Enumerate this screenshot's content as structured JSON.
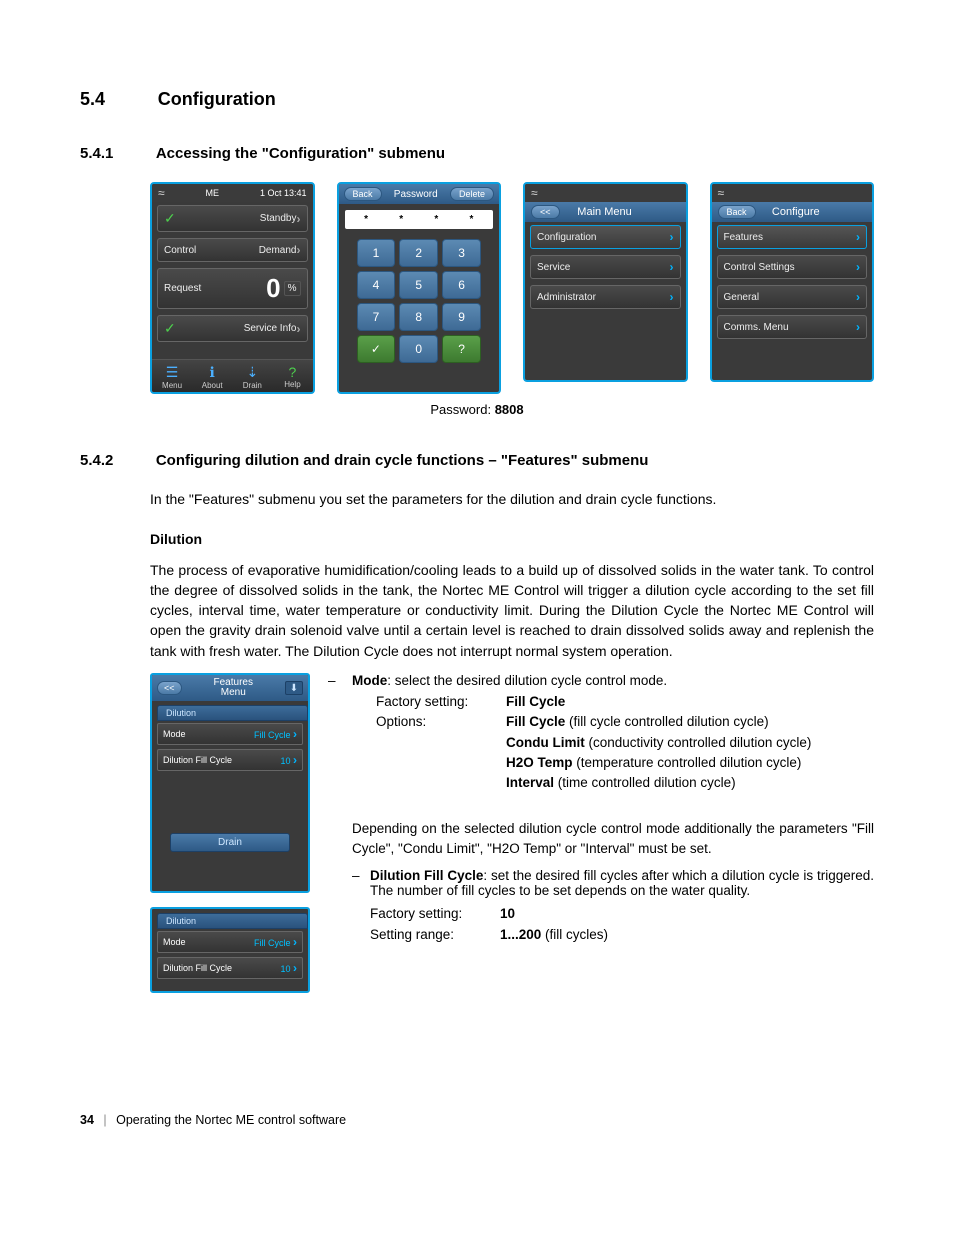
{
  "h1": {
    "num": "5.4",
    "title": "Configuration"
  },
  "h2a": {
    "num": "5.4.1",
    "title": "Accessing the \"Configuration\" submenu"
  },
  "h2b": {
    "num": "5.4.2",
    "title": "Configuring dilution and drain cycle functions – \"Features\" submenu"
  },
  "screen1": {
    "title": "ME",
    "time": "1 Oct 13:41",
    "standby": "Standby",
    "control": "Control",
    "demand": "Demand",
    "request": "Request",
    "reqVal": "0",
    "reqUnit": "%",
    "service": "Service Info",
    "bottom": {
      "menu": "Menu",
      "about": "About",
      "drain": "Drain",
      "help": "Help"
    }
  },
  "screen2": {
    "back": "Back",
    "title": "Password",
    "delete": "Delete",
    "mask": "*",
    "keys": [
      "1",
      "2",
      "3",
      "4",
      "5",
      "6",
      "7",
      "8",
      "9",
      "",
      "0",
      ""
    ]
  },
  "screen3": {
    "back": "<<",
    "title": "Main Menu",
    "items": [
      "Configuration",
      "Service",
      "Administrator"
    ]
  },
  "screen4": {
    "back": "Back",
    "title": "Configure",
    "items": [
      "Features",
      "Control Settings",
      "General",
      "Comms. Menu"
    ]
  },
  "caption": {
    "label": "Password: ",
    "value": "8808"
  },
  "intro542": "In the \"Features\" submenu you set the parameters for the dilution and drain cycle functions.",
  "dilution": {
    "heading": "Dilution",
    "para": "The process of evaporative humidification/cooling leads to a build up of dissolved solids in the water tank. To control the degree of dissolved solids in the tank, the Nortec ME Control will trigger a dilution cycle according to the set fill cycles, interval time, water temperature or conductivity limit. During the Dilution Cycle the Nortec ME Control will open the gravity drain solenoid valve until a certain level is reached to drain dissolved solids away and replenish the tank with fresh water. The Dilution Cycle does not interrupt normal system operation."
  },
  "featuresScreen": {
    "back": "<<",
    "title1": "Features",
    "title2": "Menu",
    "tab": "Dilution",
    "rows": [
      {
        "l": "Mode",
        "v": "Fill Cycle"
      },
      {
        "l": "Dilution Fill Cycle",
        "v": "10"
      }
    ],
    "drain": "Drain"
  },
  "featuresScreen2": {
    "tab": "Dilution",
    "rows": [
      {
        "l": "Mode",
        "v": "Fill Cycle"
      },
      {
        "l": "Dilution Fill Cycle",
        "v": "10"
      }
    ]
  },
  "modeDesc": {
    "lead": "Mode",
    "tail": ": select the desired dilution cycle control mode.",
    "factoryLabel": "Factory setting:",
    "factoryVal": "Fill Cycle",
    "optionsLabel": "Options:",
    "opts": [
      {
        "b": "Fill Cycle",
        "t": " (fill cycle controlled dilution cycle)"
      },
      {
        "b": "Condu Limit",
        "t": " (conductivity controlled dilution cycle)"
      },
      {
        "b": "H2O Temp",
        "t": " (temperature controlled dilution cycle)"
      },
      {
        "b": "Interval",
        "t": " (time controlled dilution cycle)"
      }
    ],
    "dep": "Depending on the selected dilution cycle control mode additionally the parameters \"Fill Cycle\", \"Condu Limit\", \"H2O Temp\" or \"Interval\" must be set."
  },
  "fillCycleDesc": {
    "lead": "Dilution Fill Cycle",
    "tail": ": set the desired fill cycles after which a dilution cycle is triggered. The number of fill cycles to be set depends on the water quality.",
    "factoryLabel": "Factory setting:",
    "factoryVal": "10",
    "rangeLabel": "Setting range:",
    "rangeVal": "1...200",
    "rangeTail": " (fill cycles)"
  },
  "footer": {
    "page": "34",
    "text": "Operating the Nortec ME control software"
  }
}
